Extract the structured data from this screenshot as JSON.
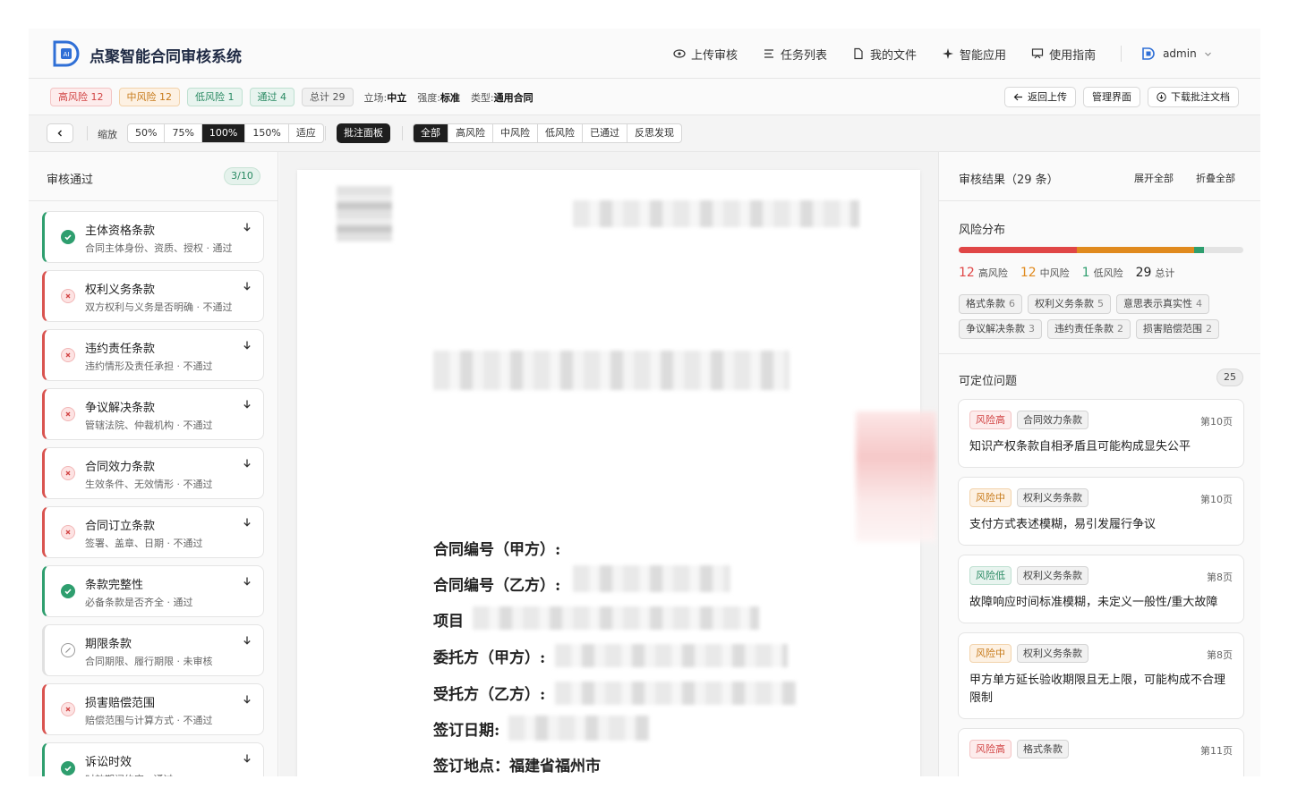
{
  "header": {
    "title": "点聚智能合同审核系统",
    "nav": [
      "上传审核",
      "任务列表",
      "我的文件",
      "智能应用",
      "使用指南"
    ],
    "user": "admin"
  },
  "status": {
    "high": "高风险 12",
    "mid": "中风险 12",
    "low": "低风险 1",
    "pass": "通过 4",
    "total": "总计 29",
    "stance_label": "立场:",
    "stance_value": "中立",
    "strength_label": "强度:",
    "strength_value": "标准",
    "type_label": "类型:",
    "type_value": "通用合同",
    "actions": [
      "返回上传",
      "管理界面",
      "下载批注文档"
    ]
  },
  "toolbar": {
    "zoom_label": "缩放",
    "zoom_options": [
      "50%",
      "75%",
      "100%",
      "150%",
      "适应"
    ],
    "zoom_active": "100%",
    "panel_button": "批注面板",
    "filters": [
      "全部",
      "高风险",
      "中风险",
      "低风险",
      "已通过",
      "反思发现"
    ],
    "filter_active": "全部"
  },
  "left_panel": {
    "title": "审核通过",
    "count": "3/10",
    "items": [
      {
        "title": "主体资格条款",
        "desc": "合同主体身份、资质、授权 · 通过",
        "status": "pass"
      },
      {
        "title": "权利义务条款",
        "desc": "双方权利与义务是否明确 · 不通过",
        "status": "fail"
      },
      {
        "title": "违约责任条款",
        "desc": "违约情形及责任承担 · 不通过",
        "status": "fail"
      },
      {
        "title": "争议解决条款",
        "desc": "管辖法院、仲裁机构 · 不通过",
        "status": "fail"
      },
      {
        "title": "合同效力条款",
        "desc": "生效条件、无效情形 · 不通过",
        "status": "fail"
      },
      {
        "title": "合同订立条款",
        "desc": "签署、盖章、日期 · 不通过",
        "status": "fail"
      },
      {
        "title": "条款完整性",
        "desc": "必备条款是否齐全 · 通过",
        "status": "pass"
      },
      {
        "title": "期限条款",
        "desc": "合同期限、履行期限 · 未审核",
        "status": "pending"
      },
      {
        "title": "损害赔偿范围",
        "desc": "赔偿范围与计算方式 · 不通过",
        "status": "fail"
      },
      {
        "title": "诉讼时效",
        "desc": "时效期间约定 · 通过",
        "status": "pass"
      }
    ]
  },
  "document": {
    "lines": [
      "合同编号（甲方）:",
      "合同编号（乙方）:",
      "项目",
      "委托方（甲方）:",
      "受托方（乙方）:",
      "签订日期:",
      "签订地点：福建省福州市"
    ]
  },
  "right_panel": {
    "title": "审核结果（29 条）",
    "expand_all": "展开全部",
    "collapse_all": "折叠全部",
    "distribution_title": "风险分布",
    "distribution": {
      "high": 12,
      "mid": 12,
      "low": 1,
      "total": 29
    },
    "legend": {
      "high_num": "12",
      "high_label": "高风险",
      "mid_num": "12",
      "mid_label": "中风险",
      "low_num": "1",
      "low_label": "低风险",
      "total_num": "29",
      "total_label": "总计"
    },
    "categories": [
      {
        "name": "格式条款",
        "count": "6"
      },
      {
        "name": "权利义务条款",
        "count": "5"
      },
      {
        "name": "意思表示真实性",
        "count": "4"
      },
      {
        "name": "争议解决条款",
        "count": "3"
      },
      {
        "name": "违约责任条款",
        "count": "2"
      },
      {
        "name": "损害赔偿范围",
        "count": "2"
      }
    ],
    "locatable_title": "可定位问题",
    "locatable_count": "25",
    "issues": [
      {
        "level": "风险高",
        "level_class": "high",
        "category": "合同效力条款",
        "page": "第10页",
        "text": "知识产权条款自相矛盾且可能构成显失公平"
      },
      {
        "level": "风险中",
        "level_class": "mid",
        "category": "权利义务条款",
        "page": "第10页",
        "text": "支付方式表述模糊，易引发履行争议"
      },
      {
        "level": "风险低",
        "level_class": "low",
        "category": "权利义务条款",
        "page": "第8页",
        "text": "故障响应时间标准模糊，未定义一般性/重大故障"
      },
      {
        "level": "风险中",
        "level_class": "mid",
        "category": "权利义务条款",
        "page": "第8页",
        "text": "甲方单方延长验收期限且无上限，可能构成不合理限制"
      },
      {
        "level": "风险高",
        "level_class": "high",
        "category": "格式条款",
        "page": "第11页",
        "text": ""
      }
    ]
  },
  "colors": {
    "high": "#e04646",
    "mid": "#e08a1e",
    "low": "#2e9e6e",
    "track": "#e3e3e3"
  }
}
